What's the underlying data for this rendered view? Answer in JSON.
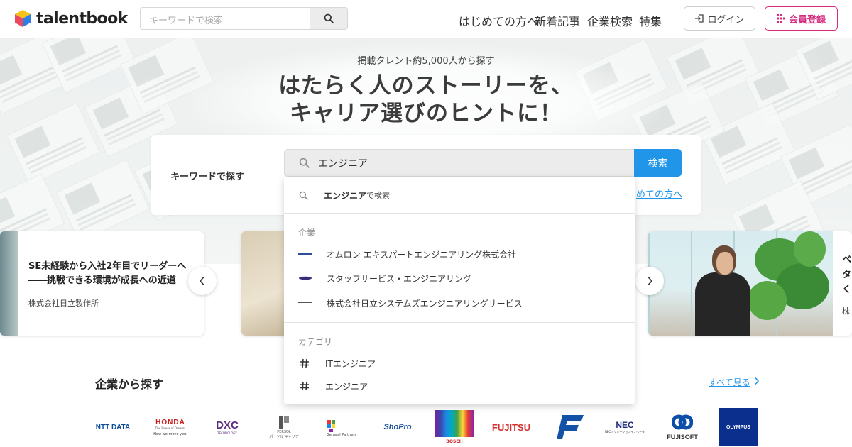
{
  "header": {
    "logo_text": "talentbook",
    "search_placeholder": "キーワードで検索",
    "nav": [
      "はじめての方へ",
      "新着記事",
      "企業検索",
      "特集"
    ],
    "login_label": "ログイン",
    "signup_label": "会員登録",
    "brand_color": "#d6287d"
  },
  "hero": {
    "subtitle": "掲載タレント約5,000人から探す",
    "title_line1": "はたらく人のストーリーを、",
    "title_line2": "キャリア選びのヒントに！",
    "search_label": "キーワードで探す",
    "search_value": "エンジニア",
    "search_button": "検索",
    "partial_link": "めての方へ"
  },
  "dropdown": {
    "query_bold": "エンジニア",
    "query_suffix": " で検索",
    "companies_heading": "企業",
    "companies": [
      {
        "name": "オムロン エキスパートエンジニアリング株式会社",
        "logo": "omron-logo"
      },
      {
        "name": "スタッフサービス・エンジニアリング",
        "logo": "staffservice-logo"
      },
      {
        "name": "株式会社日立システムズエンジニアリングサービス",
        "logo": "hitachi-logo"
      }
    ],
    "categories_heading": "カテゴリ",
    "categories": [
      "ITエンジニア",
      "エンジニア"
    ]
  },
  "carousel": {
    "left_title_line1": "SE未経験から入社2年目でリーダーへ",
    "left_title_line2": "――挑戦できる環境が成長への近道",
    "left_company": "株式会社日立製作所",
    "right_title_lines": [
      "ベ",
      "タ",
      "く"
    ],
    "right_company": "株"
  },
  "companies_section": {
    "title": "企業から探す",
    "see_all": "すべて見る",
    "logos": [
      "NTT DATA",
      "HONDA",
      "DXC",
      "PERSOL",
      "General Partners",
      "ShoPro",
      "BOSCH",
      "FUJITSU",
      "F",
      "NEC",
      "FUJISOFT",
      "OLYMPUS"
    ],
    "honda_tagline": "The Power of Dreams",
    "honda_sub": "How we move you.",
    "dxc_sub": "TECHNOLOGY",
    "persol_sub": "パーソル キャリア",
    "nec_sub": "NECソリューションイノベータ"
  }
}
